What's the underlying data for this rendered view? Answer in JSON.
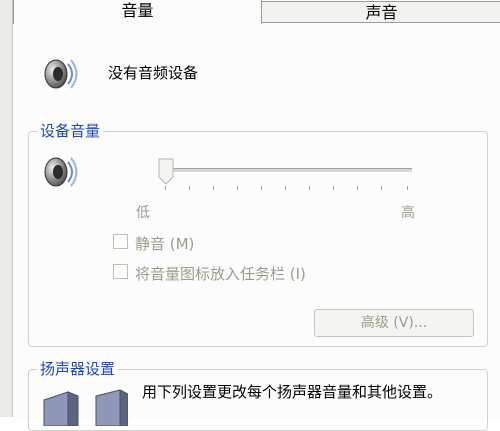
{
  "tabs": [
    {
      "label": "音量",
      "active": true
    },
    {
      "label": "声音",
      "active": false
    }
  ],
  "status_text": "没有音频设备",
  "device_volume": {
    "group_title": "设备音量",
    "slider_level": 0,
    "low_label": "低",
    "high_label": "高",
    "mute_label": "静音 (M)",
    "mute_checked": false,
    "tray_icon_label": "将音量图标放入任务栏 (I)",
    "tray_icon_checked": false,
    "advanced_button_label": "高级 (V)..."
  },
  "speaker_settings": {
    "group_title": "扬声器设置",
    "description": "用下列设置更改每个扬声器音量和其他设置。"
  },
  "colors": {
    "group_title": "#1c46c8",
    "disabled_text": "#9c9c8c"
  },
  "icons": [
    "speaker-icon",
    "speaker-icon",
    "speakers-icon"
  ]
}
